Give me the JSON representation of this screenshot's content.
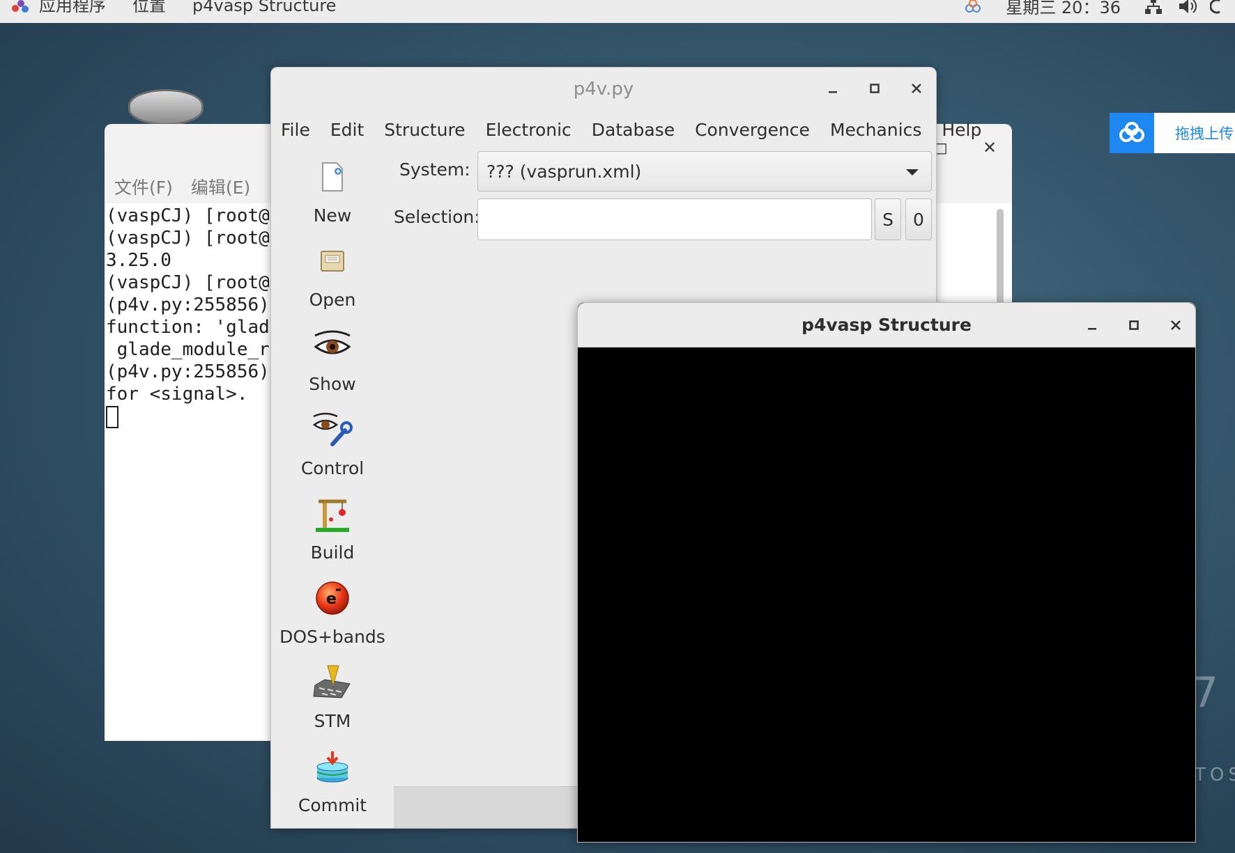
{
  "topbar": {
    "applications": "应用程序",
    "places": "位置",
    "active_app": "p4vasp Structure",
    "clock": "星期三 20：36"
  },
  "cloud_widget": {
    "text": "拖拽上传"
  },
  "watermark": {
    "big": "7",
    "small": "TOS"
  },
  "terminal": {
    "menu": [
      "文件(F)",
      "编辑(E)"
    ],
    "lines": [
      "(vaspCJ) [root@",
      "(vaspCJ) [root@",
      "3.25.0",
      "(vaspCJ) [root@",
      "",
      "(p4v.py:255856)",
      "function: 'glad",
      " glade_module_r",
      "",
      "(p4v.py:255856)",
      "for <signal>."
    ]
  },
  "p4v": {
    "title": "p4v.py",
    "menu": [
      "File",
      "Edit",
      "Structure",
      "Electronic",
      "Database",
      "Convergence",
      "Mechanics",
      "Help"
    ],
    "toolbar": [
      "New",
      "Open",
      "Show",
      "Control",
      "Build",
      "DOS+bands",
      "STM",
      "Commit"
    ],
    "system_label": "System:",
    "system_value": "??? (vasprun.xml)",
    "selection_label": "Selection:",
    "selection_value": "",
    "btn_s": "S",
    "btn_0": "0"
  },
  "structure": {
    "title": "p4vasp Structure"
  },
  "colors": {
    "accent_blue": "#1e88f0",
    "viewport_bg": "#000000"
  }
}
